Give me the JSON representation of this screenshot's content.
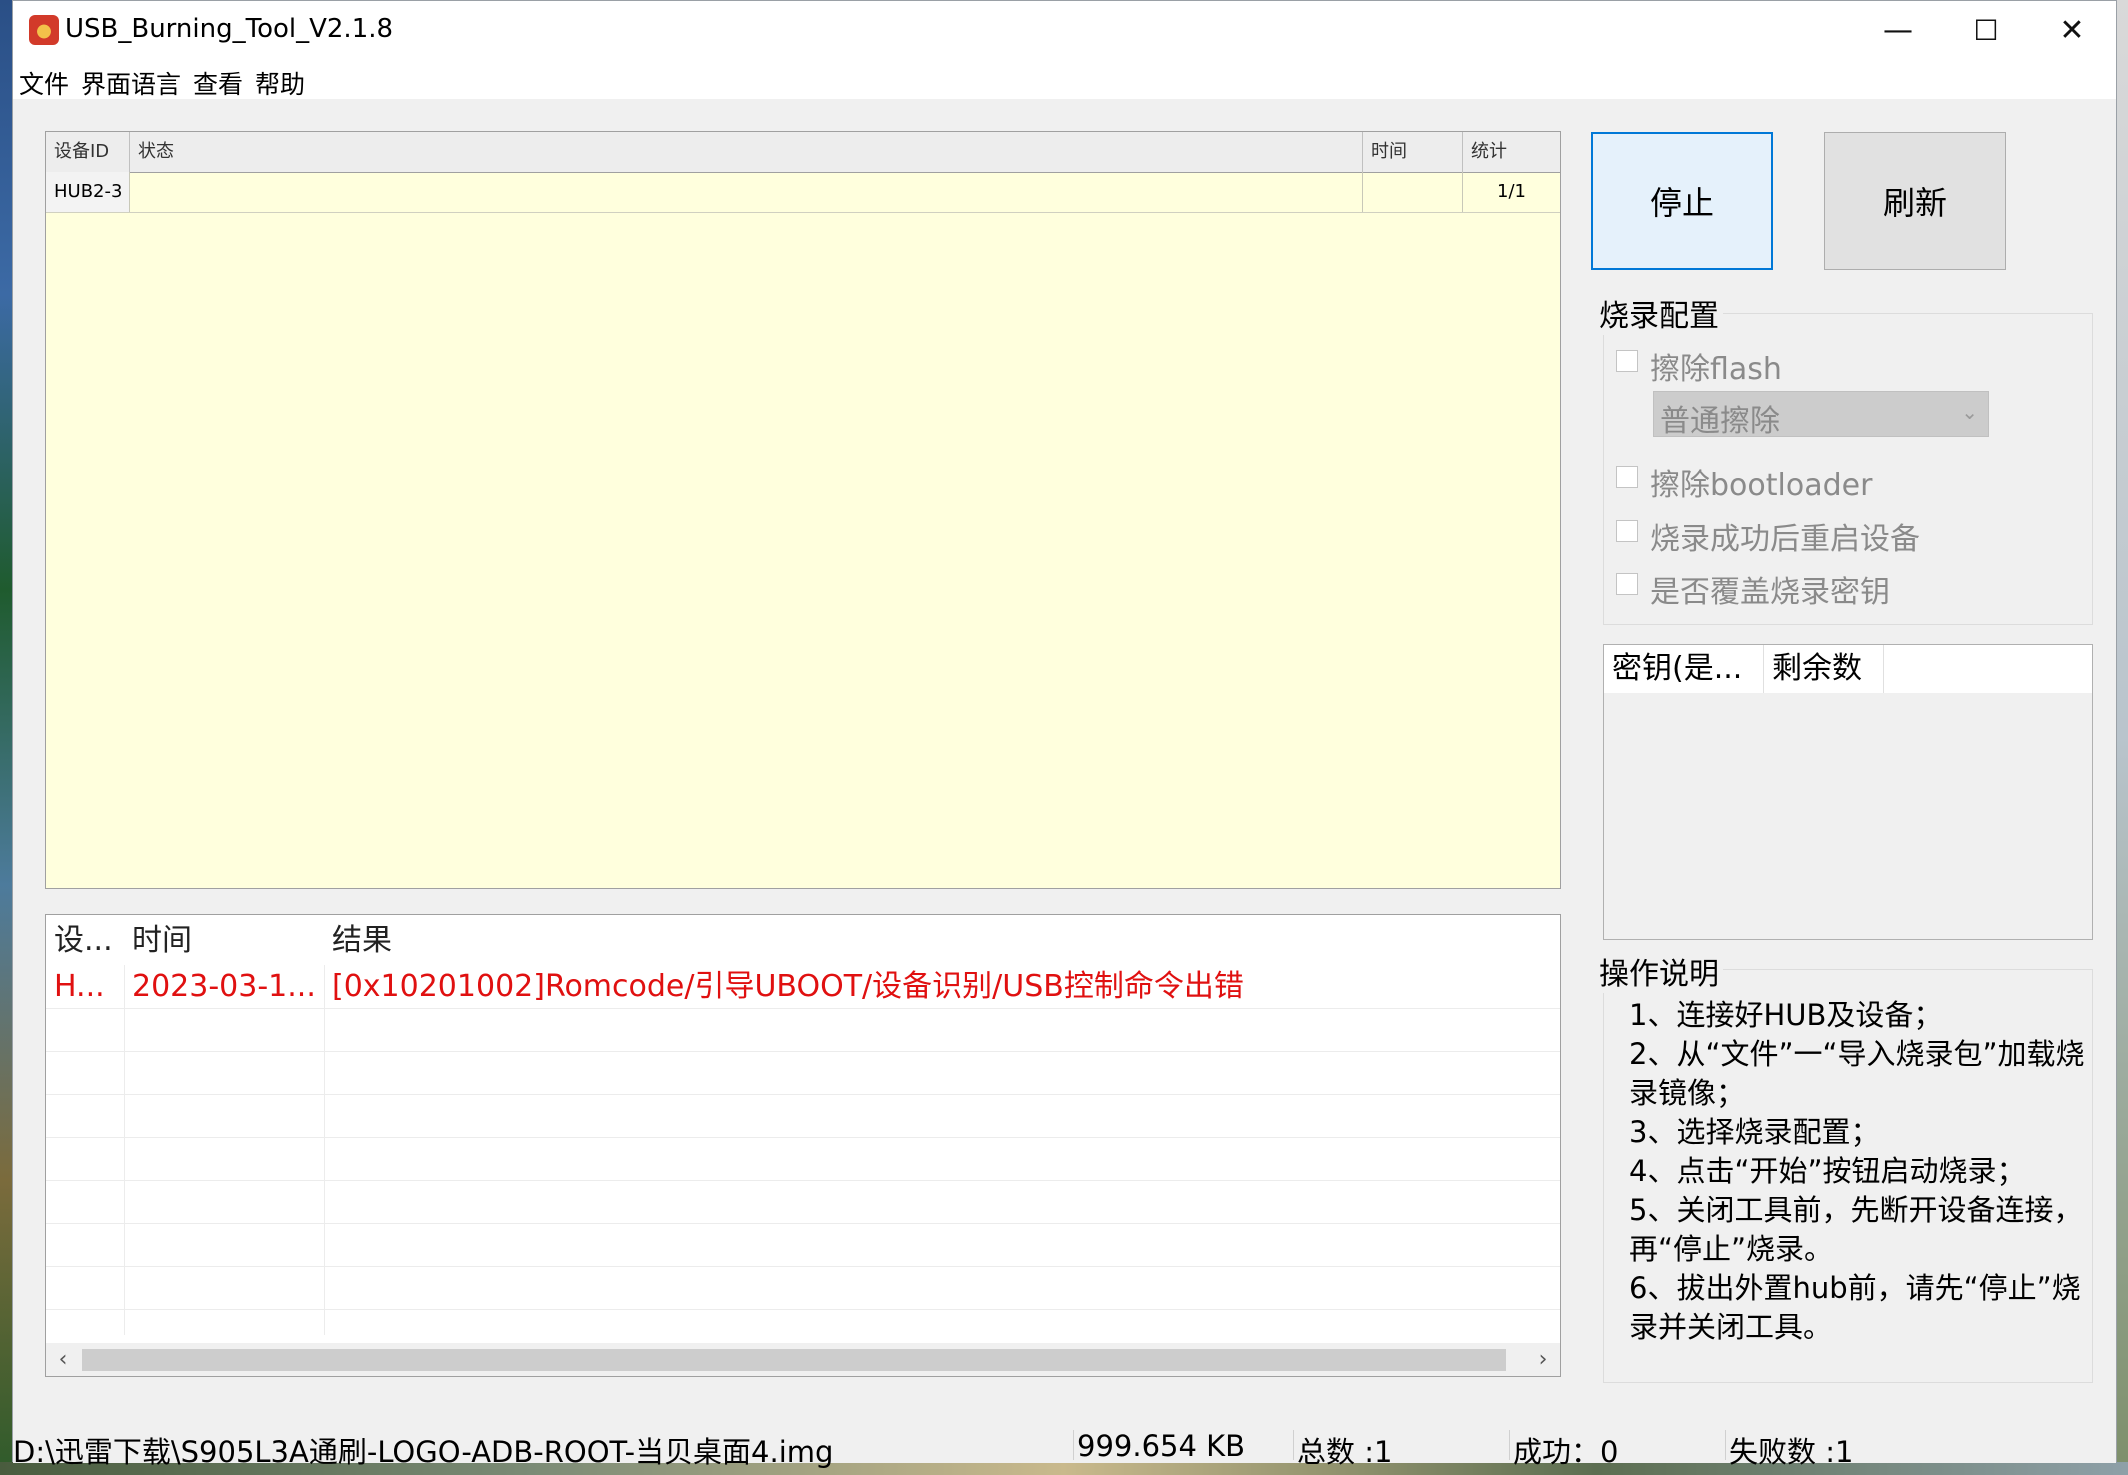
{
  "window": {
    "title": "USB_Burning_Tool_V2.1.8",
    "controls": {
      "minimize": "—",
      "maximize": "☐",
      "close": "✕"
    }
  },
  "menu": [
    "文件",
    "界面语言",
    "查看",
    "帮助"
  ],
  "device_grid": {
    "columns": [
      "设备ID",
      "状态",
      "时间",
      "统计"
    ],
    "rows": [
      {
        "id": "HUB2-3",
        "status": "",
        "time": "",
        "count": "1/1"
      }
    ]
  },
  "buttons": {
    "stop": "停止",
    "refresh": "刷新"
  },
  "burn_config": {
    "title": "烧录配置",
    "erase_flash": {
      "label": "擦除flash",
      "checked": false
    },
    "erase_mode": {
      "selected": "普通擦除"
    },
    "erase_bootloader": {
      "label": "擦除bootloader",
      "checked": false
    },
    "reboot_after": {
      "label": "烧录成功后重启设备",
      "checked": false
    },
    "overwrite_key": {
      "label": "是否覆盖烧录密钥",
      "checked": false
    }
  },
  "key_list": {
    "columns": [
      "密钥(是...",
      "剩余数"
    ]
  },
  "log_grid": {
    "columns": [
      "设...",
      "时间",
      "结果"
    ],
    "rows": [
      {
        "device": "H...",
        "time": "2023-03-1...",
        "result": "[0x10201002]Romcode/引导UBOOT/设备识别/USB控制命令出错"
      }
    ],
    "scroll_left": "‹",
    "scroll_right": "›"
  },
  "instructions": {
    "title": "操作说明",
    "lines": [
      "1、连接好HUB及设备；",
      "2、从“文件”一“导入烧录包”加载烧录镜像；",
      "3、选择烧录配置；",
      "4、点击“开始”按钮启动烧录；",
      "5、关闭工具前，先断开设备连接，再“停止”烧录。",
      "6、拔出外置hub前，请先“停止”烧录并关闭工具。"
    ]
  },
  "status_bar": {
    "path": "D:\\迅雷下载\\S905L3A通刷-LOGO-ADB-ROOT-当贝桌面4.img",
    "size": "999.654 KB",
    "total": "总数 :1",
    "success": "成功：0",
    "failed": "失败数 :1"
  },
  "colors": {
    "error_text": "#e01010",
    "device_grid_bg": "#ffffdd",
    "focus_border": "#0078d7"
  }
}
